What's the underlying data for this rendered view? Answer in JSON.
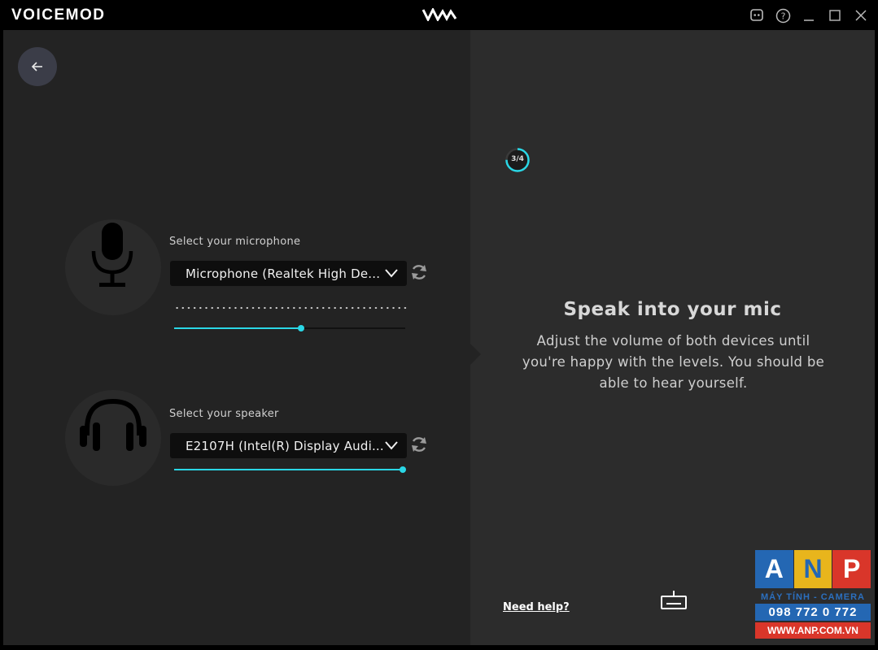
{
  "window": {
    "title": "VOICEMOD"
  },
  "microphone": {
    "label": "Select your microphone",
    "selected": "Microphone (Realtek High De...",
    "volume_level": 0.55
  },
  "speaker": {
    "label": "Select your speaker",
    "selected": "E2107H (Intel(R) Display Audi...",
    "volume_level": 1.0
  },
  "progress": {
    "step_text": "3/4",
    "fraction": 0.75
  },
  "instructions": {
    "heading": "Speak into your mic",
    "description_lines": [
      "Adjust the volume of both devices until",
      "you're happy with the levels. You should be",
      "able to hear yourself."
    ]
  },
  "footer": {
    "help_link": "Need help?"
  },
  "watermark": {
    "letters": [
      "A",
      "N",
      "P"
    ],
    "tagline": "MÁY TÍNH - CAMERA",
    "phone": "098 772 0 772",
    "site": "WWW.ANP.COM.VN"
  },
  "colors": {
    "accent": "#2ad7e6",
    "left_panel": "#232323",
    "right_panel": "#2c2c2c",
    "watermark_blue": "#2467b3",
    "watermark_yellow": "#e8b51c",
    "watermark_red": "#d9362a"
  },
  "icons": {
    "back": "arrow-left-icon",
    "microphone": "microphone-icon",
    "speaker": "headphones-icon",
    "refresh": "refresh-icon",
    "dropdown": "chevron-down-icon",
    "discord": "discord-icon",
    "help": "help-icon",
    "keyboard": "keyboard-icon"
  }
}
